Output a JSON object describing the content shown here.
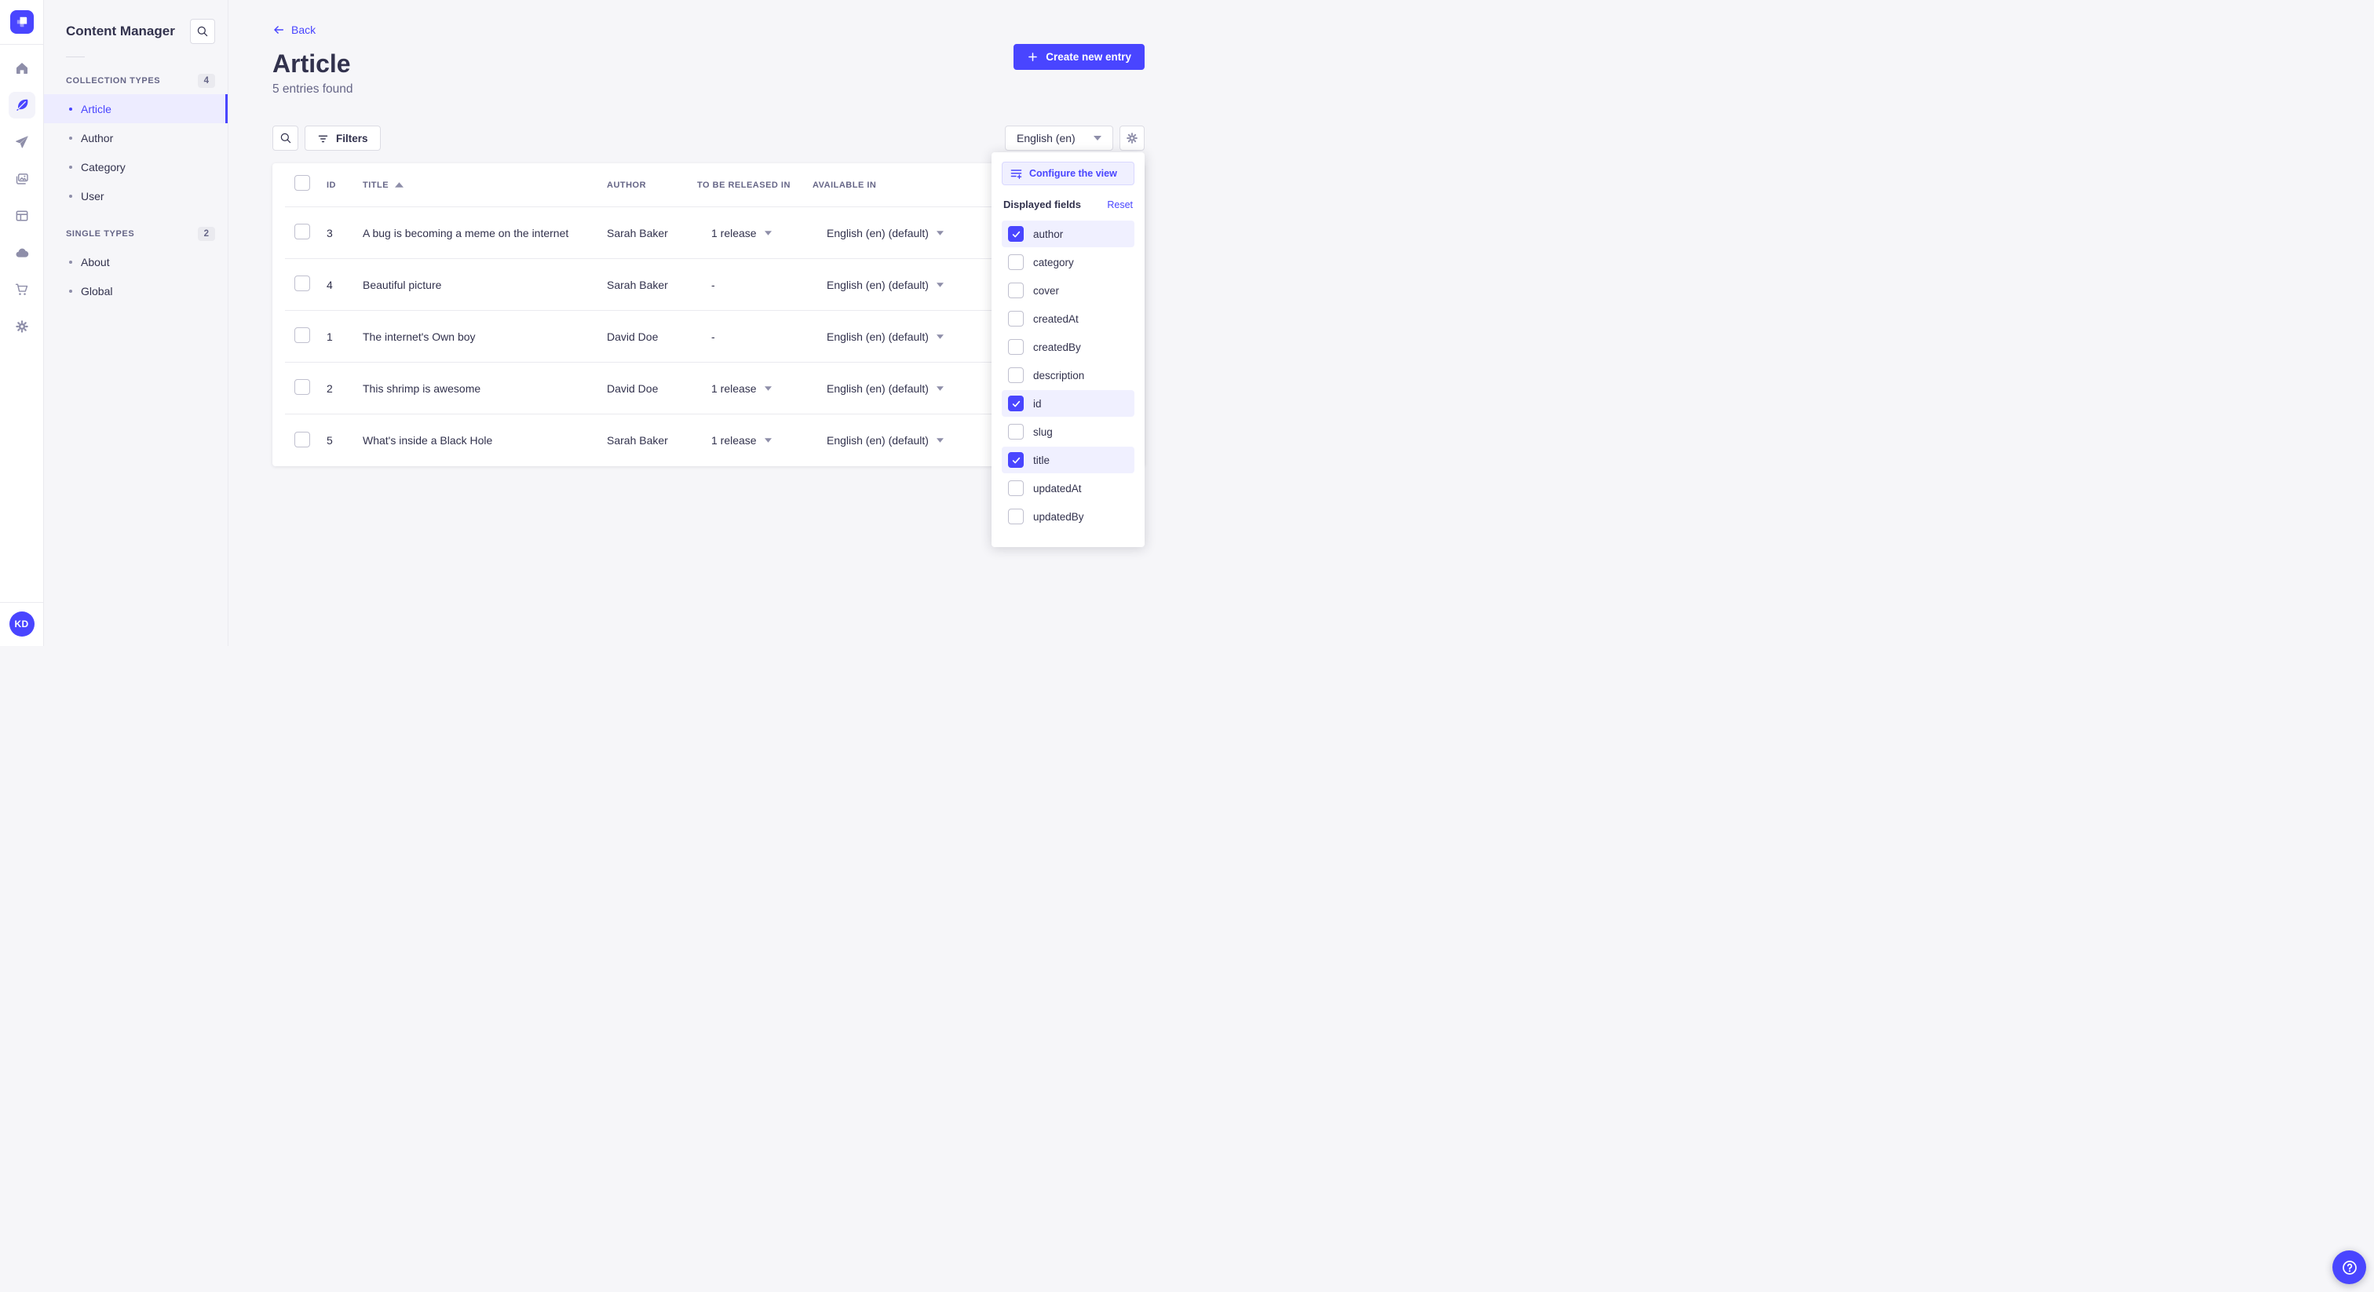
{
  "colors": {
    "primary": "#4945ff",
    "selection_bg": "#f0f0ff",
    "text": "#32324d",
    "muted": "#666687",
    "border": "#dcdce4",
    "bg": "#f6f6f9"
  },
  "icons": {
    "rail": [
      "strapi-logo",
      "home-icon",
      "content-manager-icon",
      "releases-icon",
      "media-library-icon",
      "layout-icon",
      "cloud-icon",
      "marketplace-icon",
      "settings-icon"
    ],
    "other": [
      "search-icon",
      "filter-icon",
      "chevron-down-icon",
      "sort-asc-icon",
      "arrow-left-icon",
      "plus-icon",
      "gear-icon",
      "configure-view-icon",
      "check-icon",
      "help-icon"
    ]
  },
  "rail": {
    "avatar_initials": "KD"
  },
  "sidebar": {
    "title": "Content Manager",
    "sections": [
      {
        "label": "COLLECTION TYPES",
        "count": "4",
        "items": [
          {
            "label": "Article",
            "active": true
          },
          {
            "label": "Author",
            "active": false
          },
          {
            "label": "Category",
            "active": false
          },
          {
            "label": "User",
            "active": false
          }
        ]
      },
      {
        "label": "SINGLE TYPES",
        "count": "2",
        "items": [
          {
            "label": "About",
            "active": false
          },
          {
            "label": "Global",
            "active": false
          }
        ]
      }
    ]
  },
  "header": {
    "back_label": "Back",
    "title": "Article",
    "subtitle": "5 entries found",
    "create_button_label": "Create new entry"
  },
  "toolbar": {
    "filters_label": "Filters",
    "locale_value": "English (en)"
  },
  "table": {
    "columns": {
      "id": "ID",
      "title": "TITLE",
      "author": "AUTHOR",
      "released": "TO BE RELEASED IN",
      "available": "AVAILABLE IN"
    },
    "sorted_column": "TITLE",
    "sort_direction": "asc",
    "rows": [
      {
        "id": "3",
        "title": "A bug is becoming a meme on the internet",
        "author": "Sarah Baker",
        "released": "1 release",
        "released_menu": true,
        "available": "English (en) (default)",
        "available_menu": true
      },
      {
        "id": "4",
        "title": "Beautiful picture",
        "author": "Sarah Baker",
        "released": "-",
        "released_menu": false,
        "available": "English (en) (default)",
        "available_menu": true
      },
      {
        "id": "1",
        "title": "The internet's Own boy",
        "author": "David Doe",
        "released": "-",
        "released_menu": false,
        "available": "English (en) (default)",
        "available_menu": true
      },
      {
        "id": "2",
        "title": "This shrimp is awesome",
        "author": "David Doe",
        "released": "1 release",
        "released_menu": true,
        "available": "English (en) (default)",
        "available_menu": true
      },
      {
        "id": "5",
        "title": "What's inside a Black Hole",
        "author": "Sarah Baker",
        "released": "1 release",
        "released_menu": true,
        "available": "English (en) (default)",
        "available_menu": true
      }
    ]
  },
  "popover": {
    "configure_label": "Configure the view",
    "fields_title": "Displayed fields",
    "reset_label": "Reset",
    "fields": [
      {
        "label": "author",
        "checked": true
      },
      {
        "label": "category",
        "checked": false
      },
      {
        "label": "cover",
        "checked": false
      },
      {
        "label": "createdAt",
        "checked": false
      },
      {
        "label": "createdBy",
        "checked": false
      },
      {
        "label": "description",
        "checked": false
      },
      {
        "label": "id",
        "checked": true
      },
      {
        "label": "slug",
        "checked": false
      },
      {
        "label": "title",
        "checked": true
      },
      {
        "label": "updatedAt",
        "checked": false
      },
      {
        "label": "updatedBy",
        "checked": false
      }
    ]
  }
}
